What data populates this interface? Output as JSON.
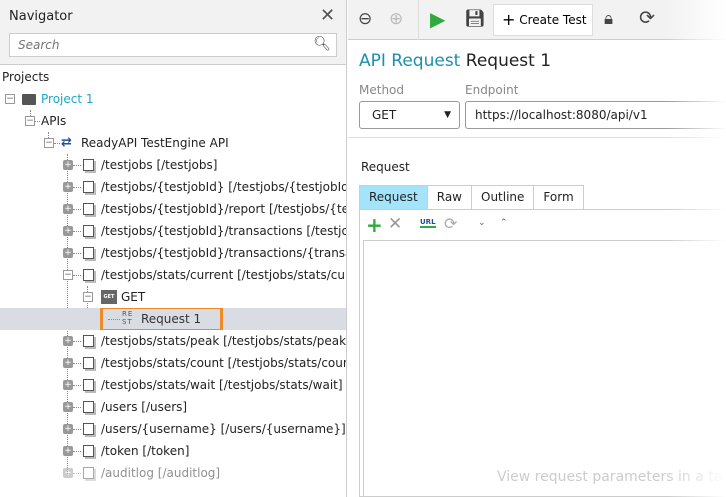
{
  "navigator": {
    "title": "Navigator",
    "search_placeholder": "Search",
    "projects_label": "Projects",
    "tree": {
      "project": "Project 1",
      "apis": "APIs",
      "api": "ReadyAPI TestEngine API",
      "resources": [
        "/testjobs [/testjobs]",
        "/testjobs/{testjobId} [/testjobs/{testjobId}]",
        "/testjobs/{testjobId}/report [/testjobs/{testjo...",
        "/testjobs/{testjobId}/transactions [/testjobs/...",
        "/testjobs/{testjobId}/transactions/{transactio...",
        "/testjobs/stats/current [/testjobs/stats/curre..."
      ],
      "method": "GET",
      "method_badge": "GET",
      "request": "Request 1",
      "request_badge": "RE ST",
      "resources_after": [
        "/testjobs/stats/peak [/testjobs/stats/peak]",
        "/testjobs/stats/count [/testjobs/stats/count]",
        "/testjobs/stats/wait [/testjobs/stats/wait]",
        "/users [/users]",
        "/users/{username} [/users/{username}]",
        "/token [/token]",
        "/auditlog [/auditlog]"
      ]
    }
  },
  "toolbar": {
    "create_test": "Create Test"
  },
  "editor": {
    "kind": "API Request",
    "name": "Request 1",
    "method_label": "Method",
    "method_value": "GET",
    "endpoint_label": "Endpoint",
    "endpoint_value": "https://localhost:8080/api/v1",
    "section": "Request",
    "tabs": [
      "Request",
      "Raw",
      "Outline",
      "Form"
    ],
    "hint": "View request parameters in a ta"
  },
  "colors": {
    "accent": "#1a8fb0",
    "selected_tab": "#a3e4fa",
    "highlight": "#f08a24",
    "run": "#2eaa3f"
  }
}
